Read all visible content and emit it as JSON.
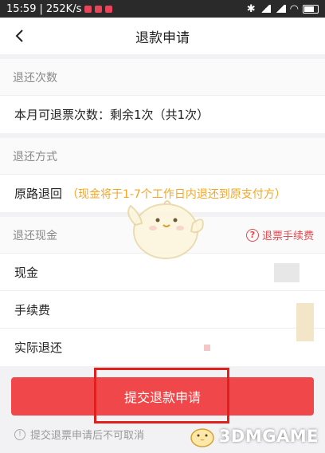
{
  "status_bar": {
    "time": "15:59",
    "speed": "252K/s"
  },
  "nav": {
    "title": "退款申请"
  },
  "refund_count": {
    "header": "退还次数",
    "row_text": "本月可退票次数：剩余1次（共1次）"
  },
  "refund_method": {
    "header": "退还方式",
    "method": "原路退回",
    "note": "（现金将于1-7个工作日内退还到原支付方）"
  },
  "refund_cash": {
    "header": "退还现金",
    "help_label": "退票手续费",
    "rows": [
      {
        "label": "现金"
      },
      {
        "label": "手续费"
      },
      {
        "label": "实际退还"
      }
    ]
  },
  "actions": {
    "submit_label": "提交退款申请",
    "notice": "提交退票申请后不可取消"
  },
  "watermark": {
    "text": "3DMGAME"
  },
  "colors": {
    "accent_red": "#f0484a",
    "note_orange": "#f5a623",
    "highlight": "#e0201c"
  }
}
